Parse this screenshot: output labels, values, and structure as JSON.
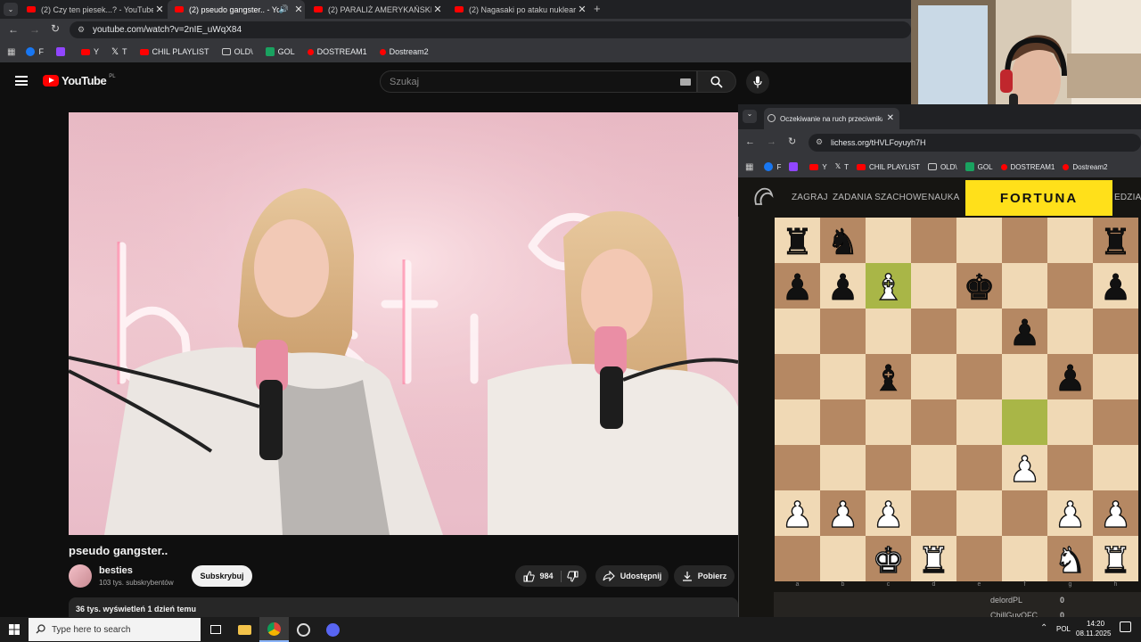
{
  "tabs": [
    {
      "title": "(2) Czy ten piesek...? - YouTube",
      "active": false
    },
    {
      "title": "(2) pseudo gangster.. - You",
      "active": true
    },
    {
      "title": "(2) PARALIŻ AMERYKAŃSKIEGO",
      "active": false
    },
    {
      "title": "(2) Nagasaki po ataku nuklearn",
      "active": false
    }
  ],
  "address": {
    "url": "youtube.com/watch?v=2nIE_uWqX84"
  },
  "bookmarks": [
    {
      "label": "F",
      "color": "#1877f2"
    },
    {
      "label": "",
      "color": "#9146ff"
    },
    {
      "label": "Y",
      "color": "#ff0000"
    },
    {
      "label": "T",
      "color": "#000000"
    },
    {
      "label": "CHIL PLAYLIST",
      "color": "#ff0000"
    },
    {
      "label": "OLD\\",
      "color": "folder"
    },
    {
      "label": "GOL",
      "color": "#1aa260"
    },
    {
      "label": "DOSTREAM1",
      "color": "#ff0000"
    },
    {
      "label": "Dostream2",
      "color": "#ff0000"
    }
  ],
  "youtube": {
    "logo": "YouTube",
    "region": "PL",
    "search_placeholder": "Szukaj",
    "video_title": "pseudo gangster..",
    "channel_name": "besties",
    "subscribers": "103 tys. subskrybentów",
    "subscribe_label": "Subskrybuj",
    "likes": "984",
    "share_label": "Udostępnij",
    "download_label": "Pobierz",
    "views_line": "36 tys. wyświetleń  1 dzień temu",
    "neon_text": "besties"
  },
  "lichess": {
    "tab_title": "Oczekiwanie na ruch przeciwnika",
    "url": "lichess.org/tHVLFoyuyh7H",
    "bookmarks": [
      {
        "label": "F",
        "color": "#1877f2"
      },
      {
        "label": "",
        "color": "#9146ff"
      },
      {
        "label": "Y",
        "color": "#ff0000"
      },
      {
        "label": "T",
        "color": "#000000"
      },
      {
        "label": "CHIL PLAYLIST",
        "color": "#ff0000"
      },
      {
        "label": "OLD\\",
        "color": "folder"
      },
      {
        "label": "GOL",
        "color": "#1aa260"
      },
      {
        "label": "DOSTREAM1",
        "color": "#ff0000"
      },
      {
        "label": "Dostream2",
        "color": "#ff0000"
      }
    ],
    "menu": [
      "ZAGRAJ",
      "ZADANIA SZACHOWE",
      "NAUKA"
    ],
    "menu_cut": "EDZIA",
    "ad_text": "FORTUNA",
    "files": [
      "a",
      "b",
      "c",
      "d",
      "e",
      "f",
      "g",
      "h"
    ],
    "board": [
      [
        "bR",
        "bN",
        "",
        "",
        "",
        "",
        "",
        "bR"
      ],
      [
        "bP",
        "bP",
        "wB",
        "",
        "bK",
        "",
        "",
        "bP"
      ],
      [
        "",
        "",
        "",
        "",
        "",
        "bP",
        "",
        ""
      ],
      [
        "",
        "",
        "bB",
        "",
        "",
        "",
        "bP",
        ""
      ],
      [
        "",
        "",
        "",
        "",
        "",
        "",
        "",
        ""
      ],
      [
        "",
        "",
        "",
        "",
        "",
        "wP",
        "",
        ""
      ],
      [
        "wP",
        "wP",
        "wP",
        "",
        "",
        "",
        "wP",
        "wP"
      ],
      [
        "",
        "",
        "wK",
        "wR",
        "",
        "",
        "wN",
        "wR"
      ]
    ],
    "highlights": [
      [
        1,
        2
      ],
      [
        4,
        5
      ]
    ],
    "players": [
      {
        "name": "delordPL",
        "score": "0"
      },
      {
        "name": "ChillGuyOFC",
        "score": "0"
      }
    ]
  },
  "taskbar": {
    "search_placeholder": "Type here to search",
    "language": "POL",
    "time": "14:20",
    "date": "08.11.2025"
  },
  "colors": {
    "yt_red": "#ff0000",
    "board_light": "#f0d9b5",
    "board_dark": "#b58863",
    "board_highlight": "#a9b647",
    "fortuna": "#ffe01a"
  }
}
